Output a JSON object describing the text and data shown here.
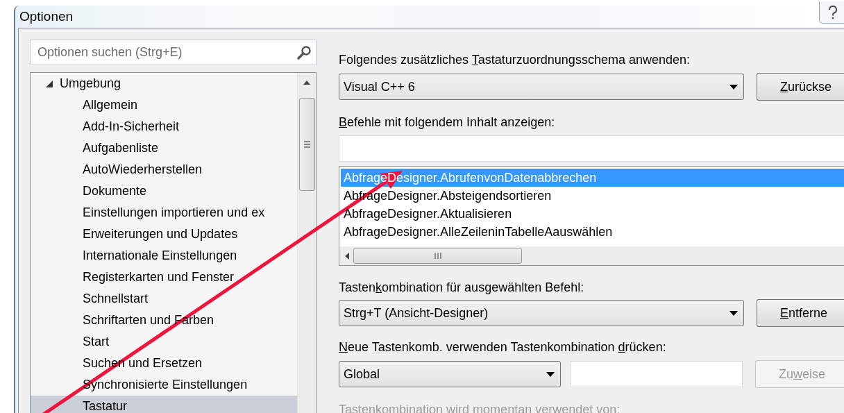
{
  "window": {
    "title": "Optionen"
  },
  "search": {
    "placeholder": "Optionen suchen (Strg+E)"
  },
  "tree": {
    "items": [
      {
        "label": "Umgebung",
        "expanded": true,
        "selected": false,
        "children": [
          {
            "label": "Allgemein",
            "selected": false
          },
          {
            "label": "Add-In-Sicherheit",
            "selected": false
          },
          {
            "label": "Aufgabenliste",
            "selected": false
          },
          {
            "label": "AutoWiederherstellen",
            "selected": false
          },
          {
            "label": "Dokumente",
            "selected": false
          },
          {
            "label": "Einstellungen importieren und ex",
            "selected": false
          },
          {
            "label": "Erweiterungen und Updates",
            "selected": false
          },
          {
            "label": "Internationale Einstellungen",
            "selected": false
          },
          {
            "label": "Registerkarten und Fenster",
            "selected": false
          },
          {
            "label": "Schnellstart",
            "selected": false
          },
          {
            "label": "Schriftarten und Farben",
            "selected": false
          },
          {
            "label": "Start",
            "selected": false
          },
          {
            "label": "Suchen und Ersetzen",
            "selected": false
          },
          {
            "label": "Synchronisierte Einstellungen",
            "selected": false
          },
          {
            "label": "Tastatur",
            "selected": true
          }
        ]
      }
    ]
  },
  "keyboard": {
    "scheme_label": {
      "before": "Folgendes zusätzliches ",
      "key": "T",
      "after": "astaturzuordnungsschema anwenden:",
      "disabled": false
    },
    "scheme_value": "Visual C++ 6",
    "reset_button": {
      "key": "Z",
      "after": "urückse",
      "disabled": false
    },
    "filter_label": {
      "key": "B",
      "after": "efehle mit folgendem Inhalt anzeigen:",
      "disabled": false
    },
    "commands": [
      {
        "label": "AbfrageDesigner.AbrufenvonDatenabbrechen",
        "selected": true
      },
      {
        "label": "AbfrageDesigner.Absteigendsortieren",
        "selected": false
      },
      {
        "label": "AbfrageDesigner.Aktualisieren",
        "selected": false
      },
      {
        "label": "AbfrageDesigner.AlleZeileninTabelleAauswählen",
        "selected": false
      }
    ],
    "shortcut_label": {
      "before": "Tasten",
      "key": "k",
      "after": "ombination für ausgewählten Befehl:",
      "disabled": false
    },
    "shortcut_value": "Strg+T (Ansicht-Designer)",
    "remove_button": {
      "key": "E",
      "after": "ntferne",
      "disabled": false
    },
    "new_label": {
      "key": "N",
      "after": "eue Tastenkomb. verwenden Tastenkombination ",
      "key2": "d",
      "after2": "rücken:",
      "disabled": false
    },
    "scope_value": "Global",
    "assign_button": {
      "before": "Zu",
      "key": "w",
      "after": "eise",
      "disabled": true
    },
    "used_by_label": {
      "before": "Tastenkombination wird ",
      "key": "m",
      "after": "omentan verwendet von:",
      "disabled": true
    }
  }
}
